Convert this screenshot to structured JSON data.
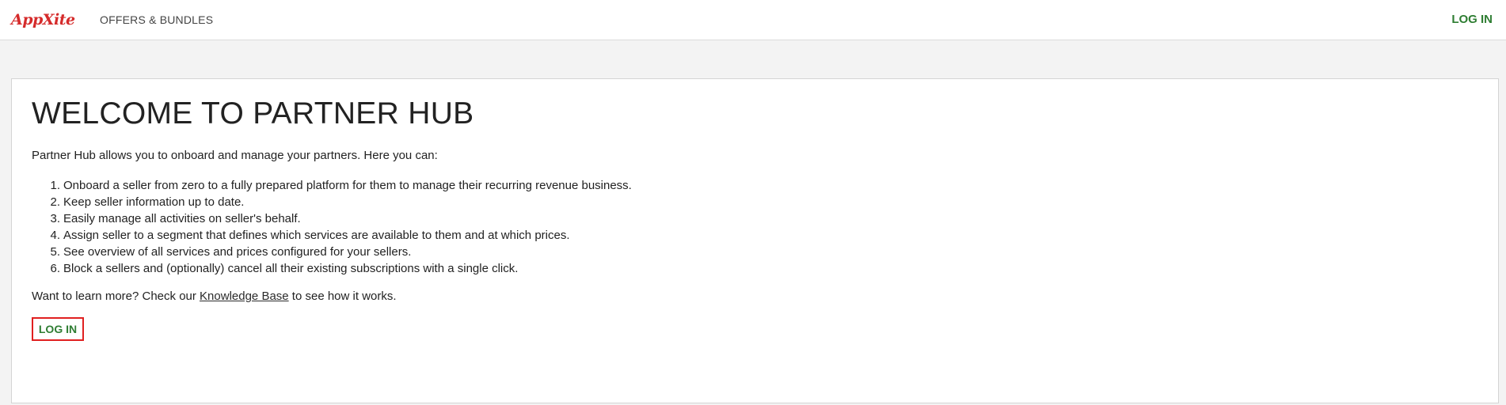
{
  "header": {
    "logo_text": "AppXite",
    "nav_offers": "OFFERS & BUNDLES",
    "nav_login": "LOG IN"
  },
  "main": {
    "title": "WELCOME TO PARTNER HUB",
    "intro": "Partner Hub allows you to onboard and manage your partners. Here you can:",
    "features": [
      {
        "num": "1.",
        "text": "Onboard a seller from zero to a fully prepared platform for them to manage their recurring revenue business."
      },
      {
        "num": "2.",
        "text": "Keep seller information up to date."
      },
      {
        "num": "3.",
        "text": "Easily manage all activities on seller's behalf."
      },
      {
        "num": "4.",
        "text": "Assign seller to a segment that defines which services are available to them and at which prices."
      },
      {
        "num": "5.",
        "text": "See overview of all services and prices configured for your sellers."
      },
      {
        "num": "6.",
        "text": "Block a sellers and (optionally) cancel all their existing subscriptions with a single click."
      }
    ],
    "learn_more_prefix": "Want to learn more? Check our ",
    "knowledge_base_link": "Knowledge Base",
    "learn_more_suffix": " to see how it works.",
    "login_button": "LOG IN"
  },
  "colors": {
    "brand_red": "#d52b2b",
    "accent_green": "#2e7d32",
    "button_border_red": "#e02020",
    "page_bg": "#f3f3f3"
  }
}
